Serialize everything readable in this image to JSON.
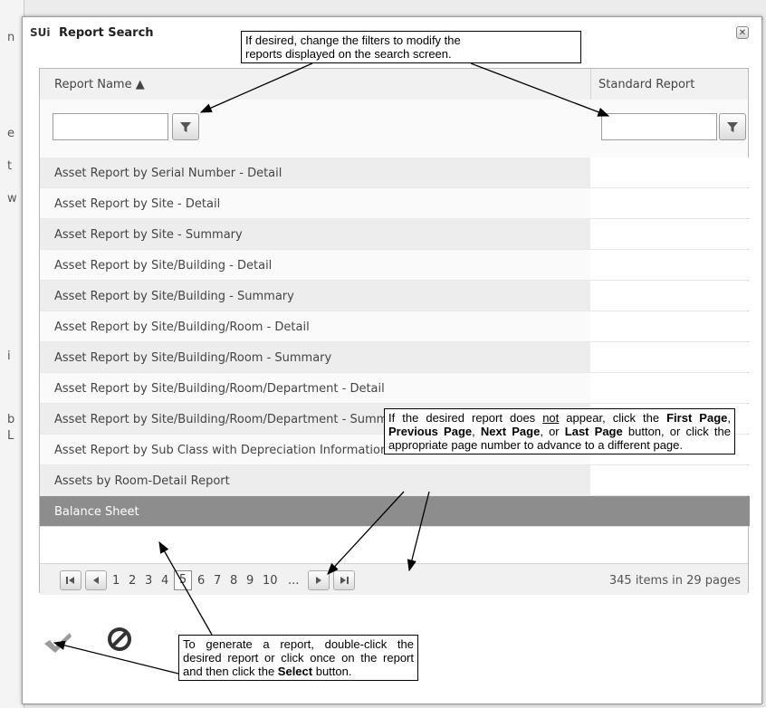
{
  "dialog": {
    "logo": "SUi",
    "title": "Report Search",
    "close_symbol": "✕"
  },
  "grid": {
    "columns": {
      "report_name": "Report Name ▲",
      "standard_report": "Standard Report"
    },
    "rows": [
      "Asset Report by Serial Number - Detail",
      "Asset Report by Site - Detail",
      "Asset Report by Site - Summary",
      "Asset Report by Site/Building - Detail",
      "Asset Report by Site/Building - Summary",
      "Asset Report by Site/Building/Room - Detail",
      "Asset Report by Site/Building/Room - Summary",
      "Asset Report by Site/Building/Room/Department - Detail",
      "Asset Report by Site/Building/Room/Department - Summary",
      "Asset Report by Sub Class with Depreciation Information",
      "Assets by Room-Detail Report",
      "Balance Sheet"
    ],
    "selected_row": "Balance Sheet"
  },
  "pager": {
    "pages": [
      "1",
      "2",
      "3",
      "4",
      "5",
      "6",
      "7",
      "8",
      "9",
      "10",
      "..."
    ],
    "current_page": "5",
    "info": "345 items in 29 pages"
  },
  "callouts": {
    "filters_line1": "If desired, change the filters to modify the",
    "filters_line2": "reports displayed on the search screen.",
    "paging_a": "If the desired report does ",
    "paging_not": "not",
    "paging_b": " appear, click the ",
    "paging_first": "First Page",
    "paging_c": ", ",
    "paging_prev": "Previous Page",
    "paging_d": ", ",
    "paging_next": "Next Page",
    "paging_e": ", or ",
    "paging_last": "Last Page",
    "paging_f": " button, or click the appropriate page number to advance to a different page.",
    "generate_a": "To generate a report, double-click the desired report or click once on the report and then click the ",
    "generate_select": "Select",
    "generate_b": " button."
  },
  "background_letters": [
    "n",
    "e",
    "t",
    "w",
    "i",
    "b",
    "L"
  ]
}
